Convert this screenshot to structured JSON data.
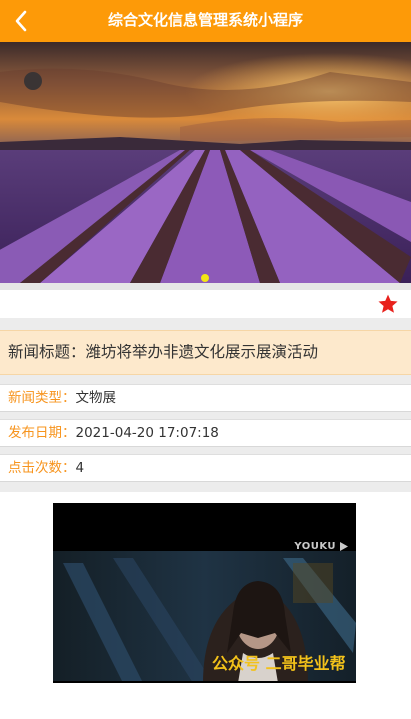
{
  "header": {
    "title": "综合文化信息管理系统小程序",
    "back_icon": "chevron-left-icon"
  },
  "banner": {
    "slide_count": 1,
    "active_index": 0
  },
  "favorite": {
    "icon": "star-icon",
    "active": true,
    "color": "#e8211c"
  },
  "article": {
    "title": "新闻标题：潍坊将举办非遗文化展示展演活动",
    "fields": [
      {
        "label": "新闻类型：",
        "value": "文物展"
      },
      {
        "label": "发布日期：",
        "value": "2021-04-20 17:07:18"
      },
      {
        "label": "点击次数：",
        "value": "4"
      }
    ]
  },
  "video": {
    "logo_text": "YOUKU",
    "play_icon": "youku-play-icon"
  },
  "watermark": "公众号 二哥毕业帮",
  "colors": {
    "accent": "#fd9a08",
    "label": "#f7941d",
    "title_bg": "#fde9cc",
    "dot_active": "#f3e515"
  }
}
